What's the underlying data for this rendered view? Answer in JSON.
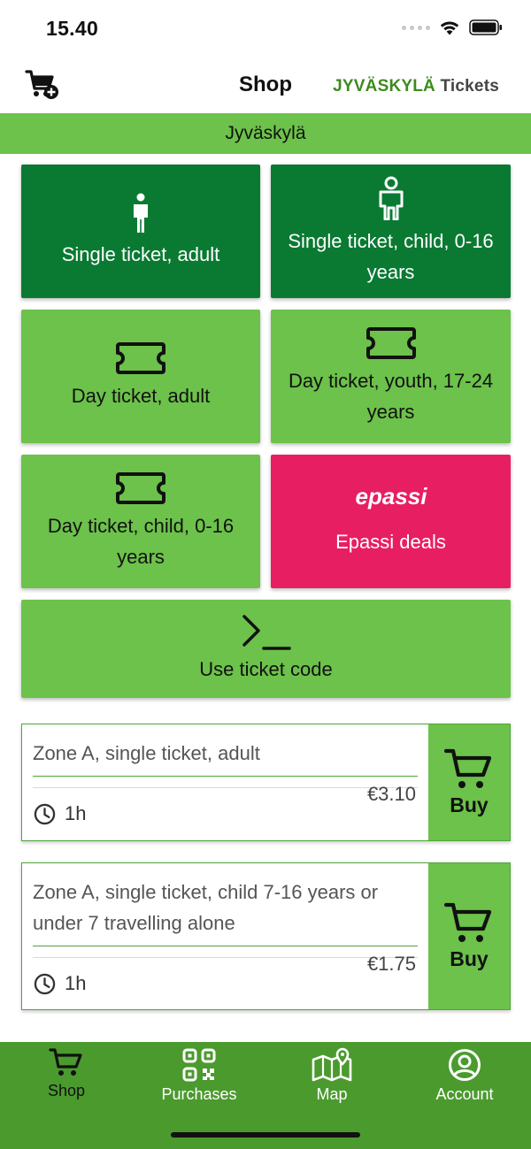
{
  "status_bar": {
    "time": "15.40"
  },
  "nav": {
    "title": "Shop",
    "brand_city": "JYVÄSKYLÄ",
    "brand_tickets": "Tickets"
  },
  "region": "Jyväskylä",
  "tiles": [
    {
      "label": "Single ticket, adult",
      "icon": "person-icon"
    },
    {
      "label": "Single ticket, child, 0-16 years",
      "icon": "child-icon"
    },
    {
      "label": "Day ticket, adult",
      "icon": "ticket-icon"
    },
    {
      "label": "Day ticket, youth, 17-24 years",
      "icon": "ticket-icon"
    },
    {
      "label": "Day ticket, child, 0-16 years",
      "icon": "ticket-icon"
    },
    {
      "label": "Epassi deals",
      "logo": "epassi"
    },
    {
      "label": "Use ticket code",
      "icon": "terminal-icon"
    }
  ],
  "products": [
    {
      "name": "Zone A, single ticket, adult",
      "price": "€3.10",
      "duration": "1h",
      "buy_label": "Buy"
    },
    {
      "name": "Zone A, single ticket, child 7-16 years or under 7 travelling alone",
      "price": "€1.75",
      "duration": "1h",
      "buy_label": "Buy"
    }
  ],
  "tab_bar": {
    "tabs": [
      {
        "label": "Shop",
        "icon": "cart-icon",
        "active": true
      },
      {
        "label": "Purchases",
        "icon": "qr-code-icon",
        "active": false
      },
      {
        "label": "Map",
        "icon": "map-icon",
        "active": false
      },
      {
        "label": "Account",
        "icon": "account-icon",
        "active": false
      }
    ]
  },
  "colors": {
    "primary_dark": "#0a7a33",
    "primary_light": "#6cc24a",
    "epassi": "#e81e63",
    "tab_bar": "#4b9a2e"
  }
}
